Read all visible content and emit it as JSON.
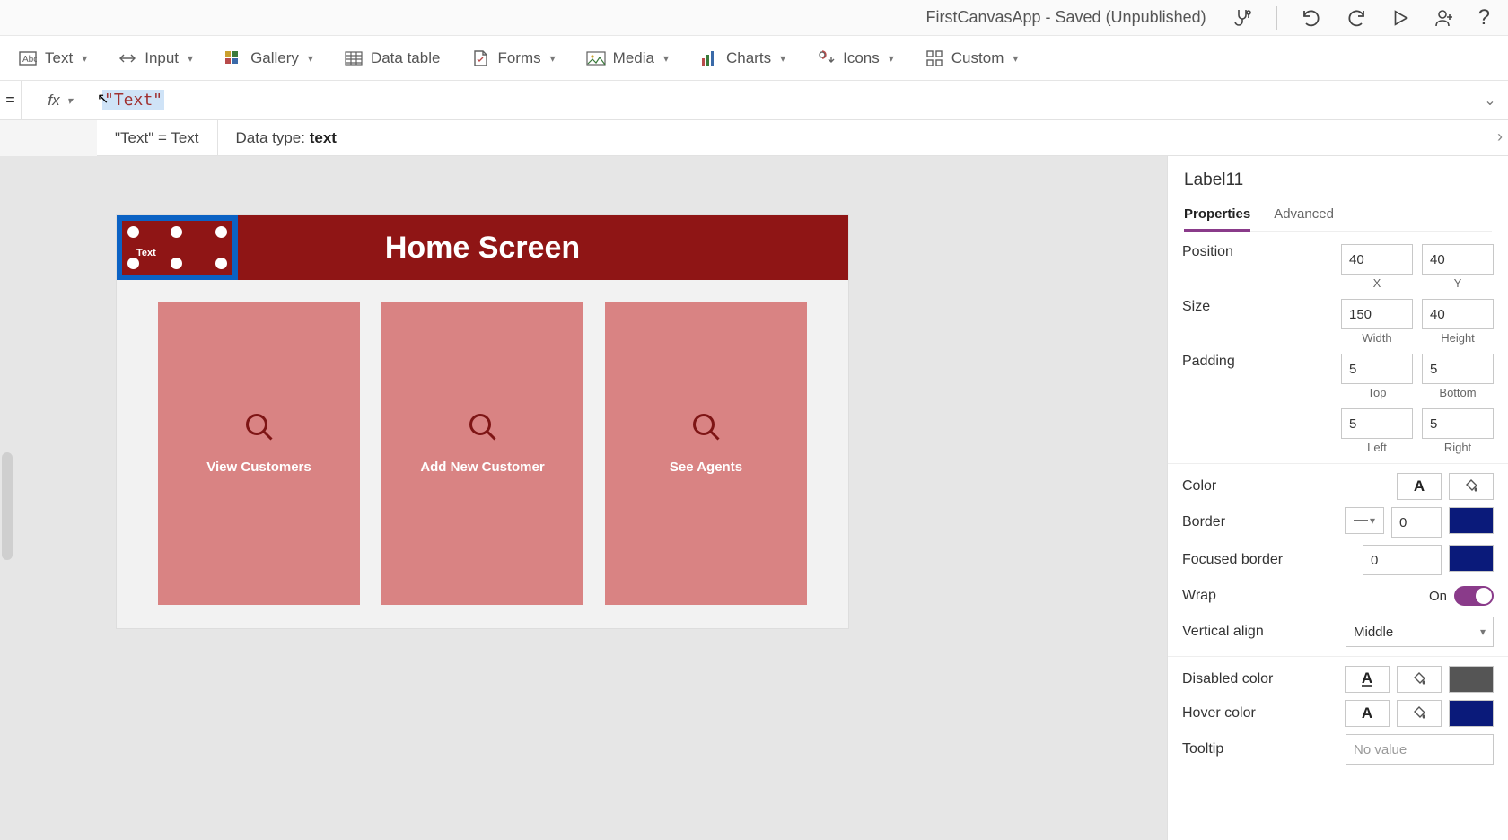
{
  "titlebar": {
    "app_title": "FirstCanvasApp - Saved (Unpublished)"
  },
  "ribbon": {
    "text": "Text",
    "input": "Input",
    "gallery": "Gallery",
    "datatable": "Data table",
    "forms": "Forms",
    "media": "Media",
    "charts": "Charts",
    "icons": "Icons",
    "custom": "Custom"
  },
  "formula": {
    "eq": "=",
    "fx": "fx",
    "value": "\"Text\"",
    "result_left": "\"Text\"  =  Text",
    "result_right_label": "Data type: ",
    "result_right_value": "text"
  },
  "canvas": {
    "header_title": "Home Screen",
    "selected_label_text": "Text",
    "tiles": [
      {
        "label": "View Customers"
      },
      {
        "label": "Add New Customer"
      },
      {
        "label": "See Agents"
      }
    ]
  },
  "props": {
    "control_name": "Label11",
    "tab_properties": "Properties",
    "tab_advanced": "Advanced",
    "rows": {
      "position": {
        "label": "Position",
        "x": "40",
        "xsub": "X",
        "y": "40",
        "ysub": "Y"
      },
      "size": {
        "label": "Size",
        "w": "150",
        "wsub": "Width",
        "h": "40",
        "hsub": "Height"
      },
      "padding": {
        "label": "Padding",
        "t": "5",
        "tsub": "Top",
        "b": "5",
        "bsub": "Bottom",
        "l": "5",
        "lsub": "Left",
        "r": "5",
        "rsub": "Right"
      },
      "color": {
        "label": "Color"
      },
      "border": {
        "label": "Border",
        "width": "0"
      },
      "focused": {
        "label": "Focused border",
        "width": "0"
      },
      "wrap": {
        "label": "Wrap",
        "on": "On"
      },
      "valign": {
        "label": "Vertical align",
        "value": "Middle"
      },
      "disabled": {
        "label": "Disabled color"
      },
      "hover": {
        "label": "Hover color"
      },
      "tooltip": {
        "label": "Tooltip",
        "placeholder": "No value"
      }
    }
  }
}
